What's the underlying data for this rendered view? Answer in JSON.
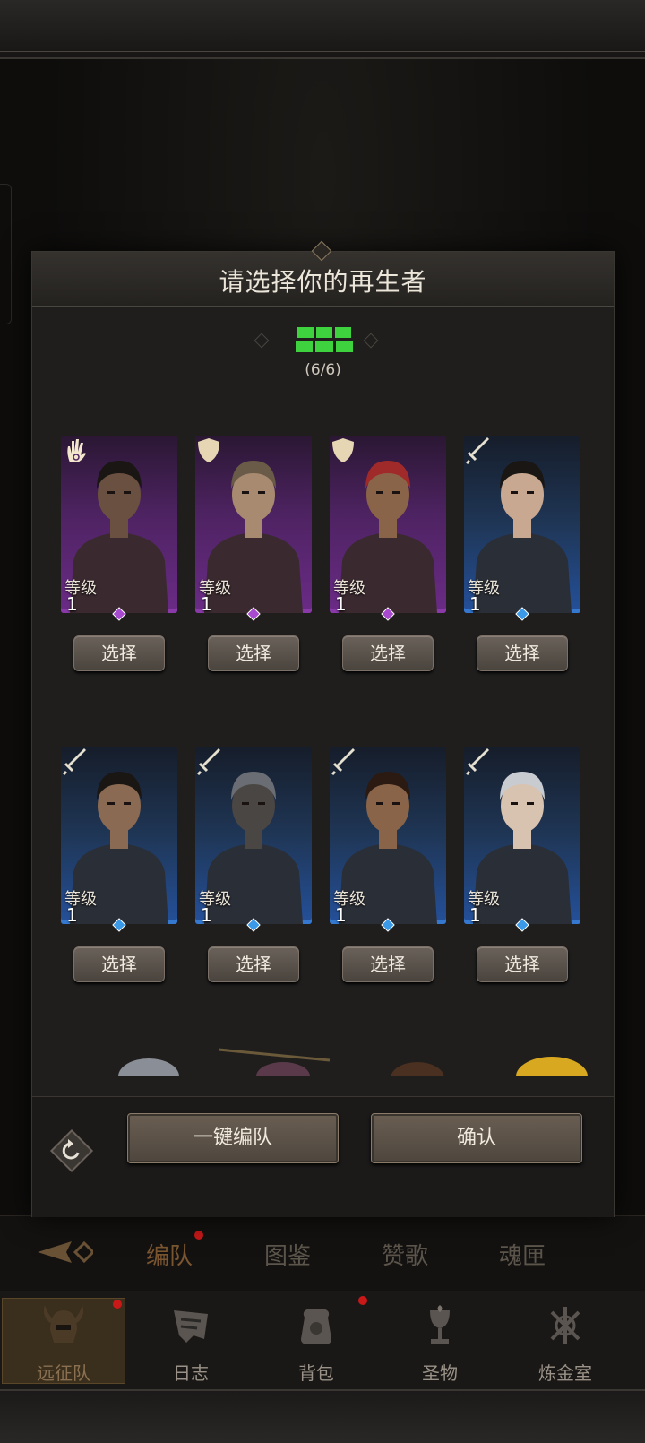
{
  "background": {
    "tabs": [
      {
        "label": "编队",
        "active": true
      },
      {
        "label": "图鉴",
        "active": false
      },
      {
        "label": "赞歌",
        "active": false
      },
      {
        "label": "魂匣",
        "active": false
      }
    ]
  },
  "bottom_nav": {
    "items": [
      {
        "label": "远征队",
        "icon": "helmet-icon",
        "active": true
      },
      {
        "label": "日志",
        "icon": "scroll-icon",
        "active": false
      },
      {
        "label": "背包",
        "icon": "bag-icon",
        "active": false
      },
      {
        "label": "圣物",
        "icon": "chalice-icon",
        "active": false
      },
      {
        "label": "炼金室",
        "icon": "alchemy-icon",
        "active": false
      }
    ]
  },
  "modal": {
    "title": "请选择你的再生者",
    "team_count": "(6/6)",
    "team_color": "#3ed33e",
    "heroes": [
      {
        "level_label": "等级",
        "level": "1",
        "rarity": "purple",
        "class_icon": "palm-icon",
        "select_label": "选择"
      },
      {
        "level_label": "等级",
        "level": "1",
        "rarity": "purple",
        "class_icon": "shield-icon",
        "select_label": "选择"
      },
      {
        "level_label": "等级",
        "level": "1",
        "rarity": "purple",
        "class_icon": "shield-icon",
        "select_label": "选择"
      },
      {
        "level_label": "等级",
        "level": "1",
        "rarity": "blue",
        "class_icon": "sword-icon",
        "select_label": "选择"
      },
      {
        "level_label": "等级",
        "level": "1",
        "rarity": "blue",
        "class_icon": "sword-icon",
        "select_label": "选择"
      },
      {
        "level_label": "等级",
        "level": "1",
        "rarity": "blue",
        "class_icon": "sword-icon",
        "select_label": "选择"
      },
      {
        "level_label": "等级",
        "level": "1",
        "rarity": "blue",
        "class_icon": "sword-icon",
        "select_label": "选择"
      },
      {
        "level_label": "等级",
        "level": "1",
        "rarity": "blue",
        "class_icon": "sword-icon",
        "select_label": "选择"
      }
    ],
    "auto_team_label": "一键编队",
    "confirm_label": "确认"
  },
  "colors": {
    "purple_rarity": "#6a2b86",
    "blue_rarity": "#24509a",
    "notification": "#c81818"
  }
}
